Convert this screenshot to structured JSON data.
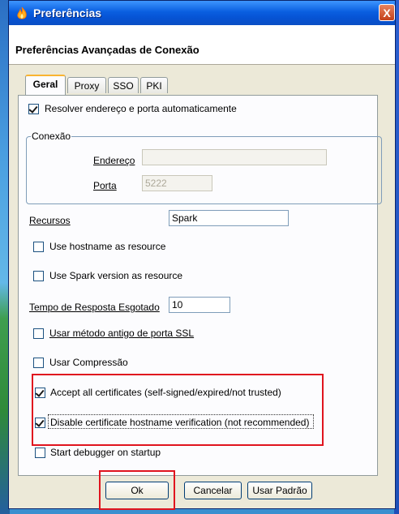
{
  "window": {
    "title": "Preferências",
    "close_glyph": "X"
  },
  "header": {
    "title": "Preferências Avançadas de Conexão"
  },
  "tabs": [
    {
      "label": "Geral",
      "active": true
    },
    {
      "label": "Proxy",
      "active": false
    },
    {
      "label": "SSO",
      "active": false
    },
    {
      "label": "PKI",
      "active": false
    }
  ],
  "general": {
    "auto_resolve": {
      "label": "Resolver endereço e porta automaticamente",
      "checked": true
    },
    "connection": {
      "legend": "Conexão",
      "address_label": "Endereço",
      "address_value": "",
      "port_label": "Porta",
      "port_placeholder": "5222"
    },
    "resources_label": "Recursos",
    "resources_value": "Spark",
    "hostname_resource": {
      "label": "Use hostname as resource",
      "checked": false
    },
    "version_resource": {
      "label": "Use Spark version as resource",
      "checked": false
    },
    "timeout_label": "Tempo de Resposta Esgotado",
    "timeout_value": "10",
    "old_ssl": {
      "label": "Usar método antigo de porta SSL",
      "checked": false
    },
    "compression": {
      "label": "Usar Compressão",
      "checked": false
    },
    "accept_certs": {
      "label": "Accept all certificates (self-signed/expired/not trusted)",
      "checked": true
    },
    "disable_hostname_verification": {
      "label": "Disable certificate hostname verification (not recommended)",
      "checked": true
    },
    "debugger": {
      "label": "Start debugger on startup",
      "checked": false
    }
  },
  "buttons": {
    "ok": "Ok",
    "cancel": "Cancelar",
    "defaults": "Usar Padrão"
  },
  "colors": {
    "highlight": "#e0141e",
    "titlebar": "#0a5fe0"
  }
}
